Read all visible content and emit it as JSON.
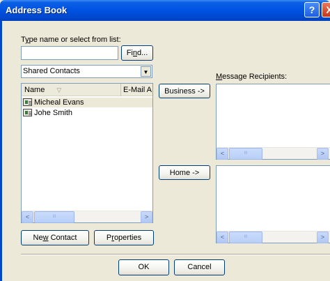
{
  "window": {
    "title": "Address Book",
    "help_glyph": "?",
    "close_glyph": "X"
  },
  "search": {
    "label_prefix": "T",
    "label_underlined": "y",
    "label_suffix": "pe name or select from list:",
    "value": "",
    "find_prefix": "Fi",
    "find_underlined": "n",
    "find_suffix": "d..."
  },
  "source": {
    "selected": "Shared Contacts",
    "arrow": "▼"
  },
  "contacts": {
    "columns": [
      {
        "label": "Name",
        "sort_glyph": "▽"
      },
      {
        "label": "E-Mail A"
      }
    ],
    "rows": [
      {
        "name": "Micheal Evans"
      },
      {
        "name": "Johe Smith"
      }
    ]
  },
  "actions": {
    "business": "Business ->",
    "home": "Home ->"
  },
  "recipients": {
    "label_underlined": "M",
    "label_suffix": "essage Recipients:"
  },
  "footer": {
    "new_contact_prefix": "Ne",
    "new_contact_underlined": "w",
    "new_contact_suffix": " Contact",
    "properties_prefix": "P",
    "properties_underlined": "r",
    "properties_suffix": "operties",
    "ok": "OK",
    "cancel": "Cancel"
  },
  "scroll": {
    "left": "<",
    "right": ">",
    "grip": "III"
  }
}
